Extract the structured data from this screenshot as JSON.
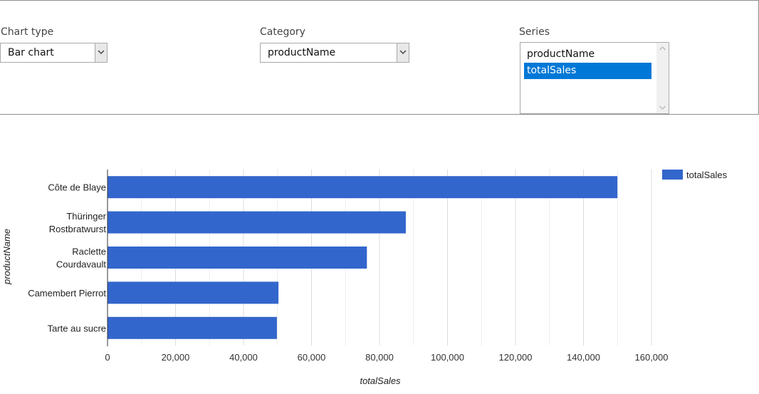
{
  "controls": {
    "chart_type": {
      "label": "Chart type",
      "value": "Bar chart"
    },
    "category": {
      "label": "Category",
      "value": "productName"
    },
    "series": {
      "label": "Series",
      "options": [
        "productName",
        "totalSales"
      ],
      "selected": "totalSales"
    }
  },
  "colors": {
    "bar": "#3366cc",
    "grid": "#e6e6e6",
    "selection": "#0078d7"
  },
  "chart_data": {
    "type": "bar",
    "orientation": "horizontal",
    "categories": [
      "Côte de Blaye",
      "Thüringer Rostbratwurst",
      "Raclette Courdavault",
      "Camembert Pierrot",
      "Tarte au sucre"
    ],
    "category_lines": [
      [
        "Côte de Blaye"
      ],
      [
        "Thüringer",
        "Rostbratwurst"
      ],
      [
        "Raclette",
        "Courdavault"
      ],
      [
        "Camembert Pierrot"
      ],
      [
        "Tarte au sucre"
      ]
    ],
    "series": [
      {
        "name": "totalSales",
        "values": [
          149984,
          87736,
          76296,
          50286,
          49828
        ]
      }
    ],
    "xlabel": "totalSales",
    "ylabel": "productName",
    "xlim": [
      0,
      160000
    ],
    "xticks": [
      0,
      20000,
      40000,
      60000,
      80000,
      100000,
      120000,
      140000,
      160000
    ],
    "xtick_labels": [
      "0",
      "20,000",
      "40,000",
      "60,000",
      "80,000",
      "100,000",
      "120,000",
      "140,000",
      "160,000"
    ],
    "grid": true,
    "legend": "top-right"
  }
}
